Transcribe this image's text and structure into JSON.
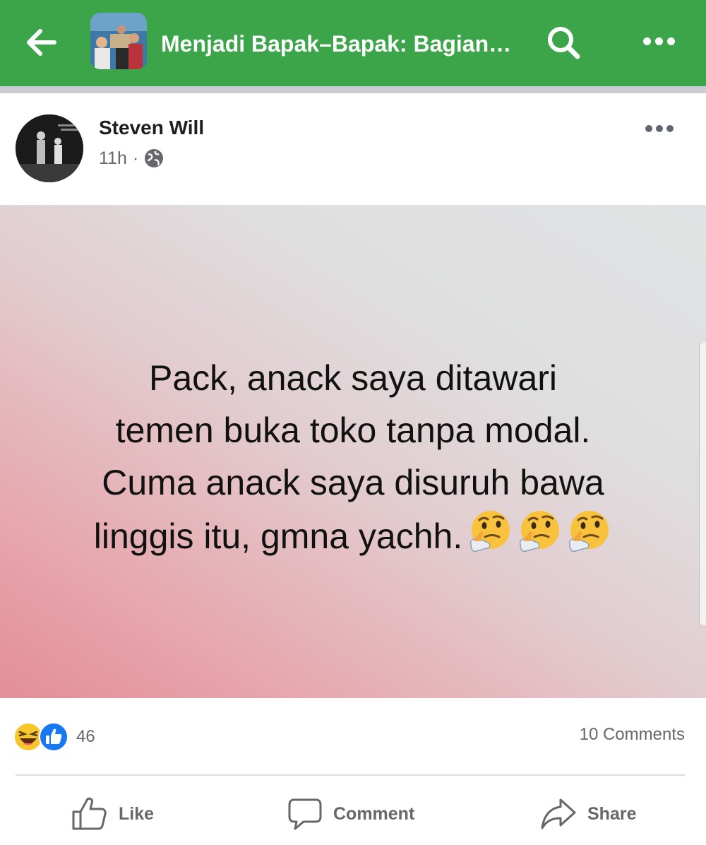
{
  "header": {
    "group_title": "Menjadi Bapak–Bapak: Bagian…",
    "back_icon": "arrow-left-icon",
    "search_icon": "search-icon",
    "more_icon": "more-horizontal-icon",
    "bar_color": "#3ca54a"
  },
  "post": {
    "author": "Steven Will",
    "time": "11h",
    "separator": "·",
    "privacy_icon": "globe-icon",
    "text_lines": [
      "Pack, anack saya ditawari",
      "temen buka toko tanpa modal.",
      "Cuma anack saya disuruh bawa",
      "linggis itu, gmna yachh."
    ],
    "emoji_icon": "thinking-face-icon",
    "emoji_count": 3
  },
  "engagement": {
    "reaction_icons": [
      "laughing-face-icon",
      "like-icon"
    ],
    "reaction_count": "46",
    "comments": "10 Comments"
  },
  "actions": {
    "like": "Like",
    "comment": "Comment",
    "share": "Share"
  }
}
